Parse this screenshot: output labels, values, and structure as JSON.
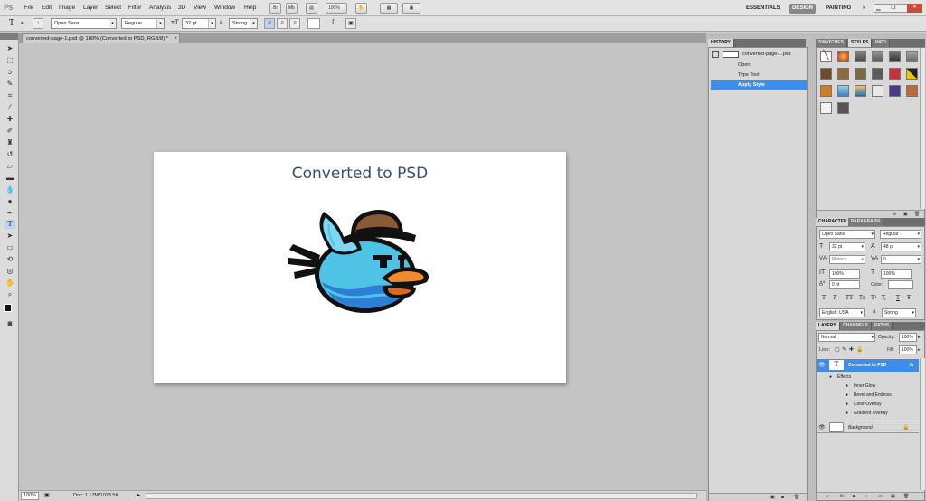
{
  "app": {
    "logo": "Ps"
  },
  "menu": [
    "File",
    "Edit",
    "Image",
    "Layer",
    "Select",
    "Filter",
    "Analysis",
    "3D",
    "View",
    "Window",
    "Help"
  ],
  "appbar": {
    "br": "Br",
    "mb": "Mb",
    "zoom": "100%"
  },
  "workspaces": [
    "ESSENTIALS",
    "DESIGN",
    "PAINTING",
    "»"
  ],
  "options": {
    "font_family": "Open Sans",
    "font_style": "Regular",
    "font_size": "32 pt",
    "aa_label": "a",
    "antialias": "Strong"
  },
  "document": {
    "tab_title": "converted-page-1.psd @ 100% (Converted to PSD, RGB/8) *",
    "tab_close": "×",
    "canvas_text": "Converted to PSD"
  },
  "status": {
    "zoom": "100%",
    "doc": "Doc: 1.17M/1023.5K"
  },
  "history": {
    "tab": "HISTORY",
    "snapshot": "converted-page-1.psd",
    "items": [
      "Open",
      "Type Tool",
      "Apply Style"
    ]
  },
  "swatches": {
    "tabs": [
      "SWATCHES",
      "STYLES",
      "INFO"
    ]
  },
  "character": {
    "tabs": [
      "CHARACTER",
      "PARAGRAPH"
    ],
    "font_family": "Open Sans",
    "font_style": "Regular",
    "size": "32 pt",
    "leading": "48 pt",
    "kerning": "Metrics",
    "tracking": "0",
    "vscale": "100%",
    "hscale": "100%",
    "baseline": "0 pt",
    "color_label": "Color:",
    "language": "English: USA",
    "aa_label": "a",
    "antialias": "Strong",
    "styles": [
      "T",
      "T",
      "TT",
      "Tr",
      "T¹",
      "T,",
      "T",
      "Ŧ"
    ]
  },
  "layers": {
    "tabs": [
      "LAYERS",
      "CHANNELS",
      "PATHS"
    ],
    "blend": "Normal",
    "opacity_label": "Opacity:",
    "opacity": "100%",
    "lock_label": "Lock:",
    "fill_label": "Fill:",
    "fill": "100%",
    "text_layer": "Converted to PSD",
    "fx": "fx",
    "effects_label": "Effects",
    "effects": [
      "Inner Glow",
      "Bevel and Emboss",
      "Color Overlay",
      "Gradient Overlay"
    ],
    "background": "Background"
  },
  "colors": {
    "accent": "#3d8ee8",
    "title": "#34506e",
    "bird_blue": "#4fc3e6",
    "beak": "#f08a2c",
    "hat": "#8a5a34"
  }
}
